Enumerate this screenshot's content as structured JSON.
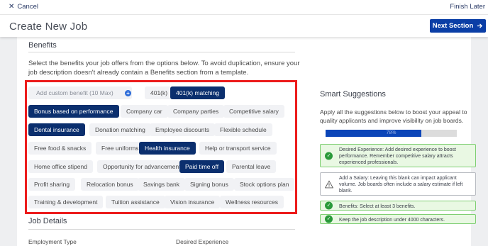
{
  "topbar": {
    "cancel": "Cancel",
    "finish": "Finish Later"
  },
  "header": {
    "title": "Create New Job",
    "next": "Next Section"
  },
  "benefits": {
    "title": "Benefits",
    "description": "Select the benefits your job offers from the options below. To avoid duplication, ensure your job description doesn't already contain a Benefits section from a template.",
    "custom_placeholder": "Add custom benefit (10 Max)",
    "chips": [
      "401(k)",
      "401(k) matching",
      "Bonus based on performance",
      "Company car",
      "Company parties",
      "Competitive salary",
      "Dental insurance",
      "Donation matching",
      "Employee discounts",
      "Flexible schedule",
      "Free food & snacks",
      "Free uniforms",
      "Health insurance",
      "Help or transport service",
      "Home office stipend",
      "Opportunity for advancement",
      "Paid time off",
      "Parental leave",
      "Profit sharing",
      "Relocation bonus",
      "Savings bank",
      "Signing bonus",
      "Stock options plan",
      "Training & development",
      "Tuition assistance",
      "Vision insurance",
      "Wellness resources"
    ],
    "selected": [
      "401(k) matching",
      "Bonus based on performance",
      "Dental insurance",
      "Health insurance",
      "Paid time off"
    ]
  },
  "job_details": {
    "title": "Job Details",
    "employment_type": "Employment Type",
    "desired_experience": "Desired Experience"
  },
  "smart": {
    "title": "Smart Suggestions",
    "desc": "Apply all the suggestions below to boost your appeal to quality applicants and improve visibility on job boards.",
    "progress_label": "78%",
    "progress_value": 0.73,
    "suggestions": [
      {
        "text": "Desired Experience: Add desired experience to boost performance. Remember competitive salary attracts experienced professionals.",
        "status": "done"
      },
      {
        "text": "Add a Salary: Leaving this blank can impact applicant volume. Job boards often include a salary estimate if left blank.",
        "status": "warning"
      },
      {
        "text": "Benefits: Select at least 3 benefits.",
        "status": "done"
      },
      {
        "text": "Keep the job description under 4000 characters.",
        "status": "done"
      }
    ]
  },
  "colors": {
    "primary": "#0a3ea6",
    "selected_chip": "#0b2f6e",
    "highlight": "#ec1c1c",
    "success": "#2a9a3a"
  }
}
